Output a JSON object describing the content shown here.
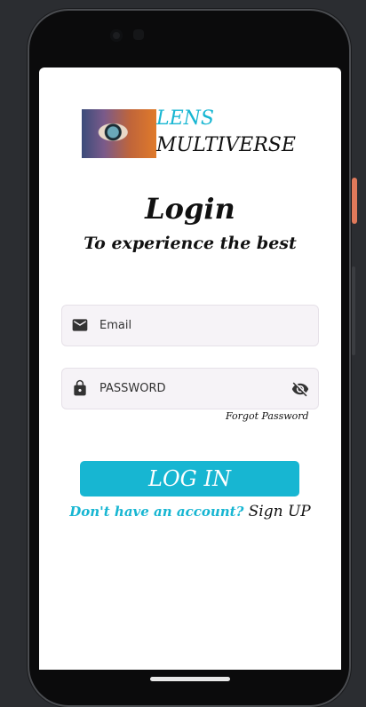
{
  "brand": {
    "line1": "LENS",
    "line2": "MULTIVERSE"
  },
  "header": {
    "title": "Login",
    "subtitle": "To experience the best"
  },
  "form": {
    "email_placeholder": "Email",
    "password_placeholder": "PASSWORD",
    "forgot_label": "Forgot Password",
    "login_label": "LOG IN",
    "signup_prompt": "Don't have an account?",
    "signup_label": "Sign UP"
  },
  "icons": {
    "email": "mail-icon",
    "password": "lock-icon",
    "visibility": "visibility-off-icon"
  },
  "colors": {
    "accent": "#17b6d2",
    "text": "#111111",
    "field_bg": "#f6f3f7"
  }
}
